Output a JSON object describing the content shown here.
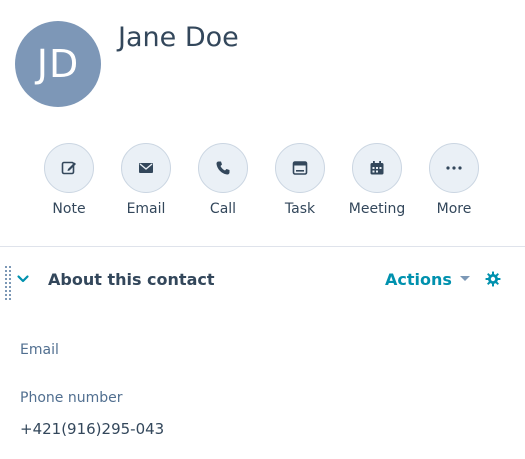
{
  "contact": {
    "initials": "JD",
    "name": "Jane Doe"
  },
  "quick_actions": [
    {
      "label": "Note",
      "icon": "note-edit-icon"
    },
    {
      "label": "Email",
      "icon": "envelope-icon"
    },
    {
      "label": "Call",
      "icon": "phone-icon"
    },
    {
      "label": "Task",
      "icon": "task-icon"
    },
    {
      "label": "Meeting",
      "icon": "calendar-icon"
    },
    {
      "label": "More",
      "icon": "more-dots-icon"
    }
  ],
  "section": {
    "title": "About this contact",
    "actions_label": "Actions"
  },
  "properties": {
    "email": {
      "label": "Email",
      "value": ""
    },
    "phone": {
      "label": "Phone number",
      "value": "+421(916)295-043"
    }
  },
  "colors": {
    "avatar": "#7d97b7",
    "accent": "#0091ae",
    "text": "#33475b",
    "action_circle": "#eaf0f6"
  }
}
